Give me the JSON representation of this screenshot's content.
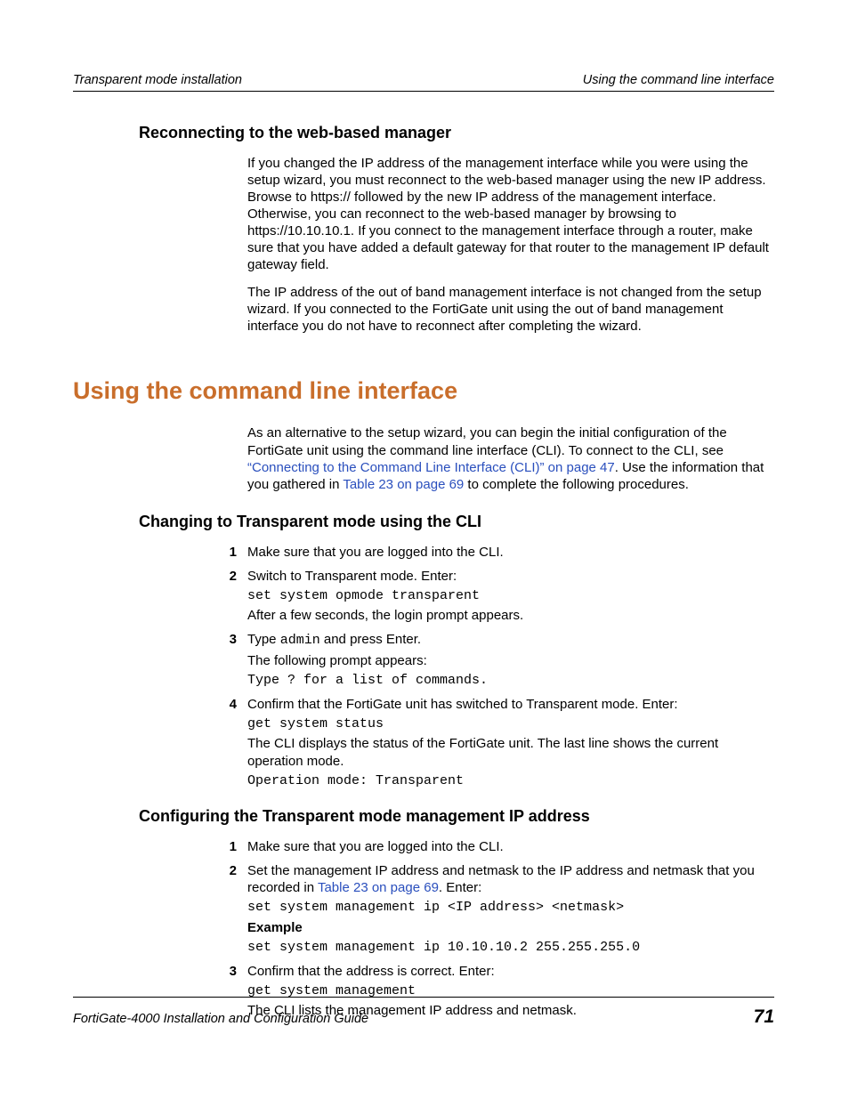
{
  "header": {
    "left": "Transparent mode installation",
    "right": "Using the command line interface"
  },
  "section1": {
    "heading": "Reconnecting to the web-based manager",
    "p1": "If you changed the IP address of the management interface while you were using the setup wizard, you must reconnect to the web-based manager using the new IP address. Browse to https:// followed by the new IP address of the management interface. Otherwise, you can reconnect to the web-based manager by browsing to https://10.10.10.1. If you connect to the management interface through a router, make sure that you have added a default gateway for that router to the management IP default gateway field.",
    "p2": "The IP address of the out of band management interface is not changed from the setup wizard. If you connected to the FortiGate unit using the out of band management interface you do not have to reconnect after completing the wizard."
  },
  "section2": {
    "heading": "Using the command line interface",
    "intro_pre": "As an alternative to the setup wizard, you can begin the initial configuration of the FortiGate unit using the command line interface (CLI). To connect to the CLI, see ",
    "intro_link1": "“Connecting to the Command Line Interface (CLI)” on page 47",
    "intro_mid": ". Use the information that you gathered in ",
    "intro_link2": "Table 23 on page 69",
    "intro_post": " to complete the following procedures."
  },
  "section3": {
    "heading": "Changing to Transparent mode using the CLI",
    "steps": {
      "s1": {
        "line1": "Make sure that you are logged into the CLI."
      },
      "s2": {
        "line1": "Switch to Transparent mode. Enter:",
        "code1": "set system opmode transparent",
        "line2": "After a few seconds, the login prompt appears."
      },
      "s3": {
        "line1_pre": "Type ",
        "line1_code": "admin",
        "line1_post": " and press Enter.",
        "line2": "The following prompt appears:",
        "code1": "Type ? for a list of commands."
      },
      "s4": {
        "line1": "Confirm that the FortiGate unit has switched to Transparent mode. Enter:",
        "code1": "get system status",
        "line2": "The CLI displays the status of the FortiGate unit. The last line shows the current operation mode.",
        "code2": "Operation mode: Transparent"
      }
    }
  },
  "section4": {
    "heading": "Configuring the Transparent mode management IP address",
    "steps": {
      "s1": {
        "line1": "Make sure that you are logged into the CLI."
      },
      "s2": {
        "line1_pre": "Set the management IP address and netmask to the IP address and netmask that you recorded in ",
        "line1_link": "Table 23 on page 69",
        "line1_post": ". Enter:",
        "code1": "set system management ip <IP address> <netmask>",
        "example_label": "Example",
        "code2": "set system management ip 10.10.10.2 255.255.255.0"
      },
      "s3": {
        "line1": "Confirm that the address is correct. Enter:",
        "code1": "get system management",
        "line2": "The CLI lists the management IP address and netmask."
      }
    }
  },
  "footer": {
    "left": "FortiGate-4000 Installation and Configuration Guide",
    "page": "71"
  },
  "numbers": {
    "n1": "1",
    "n2": "2",
    "n3": "3",
    "n4": "4"
  }
}
